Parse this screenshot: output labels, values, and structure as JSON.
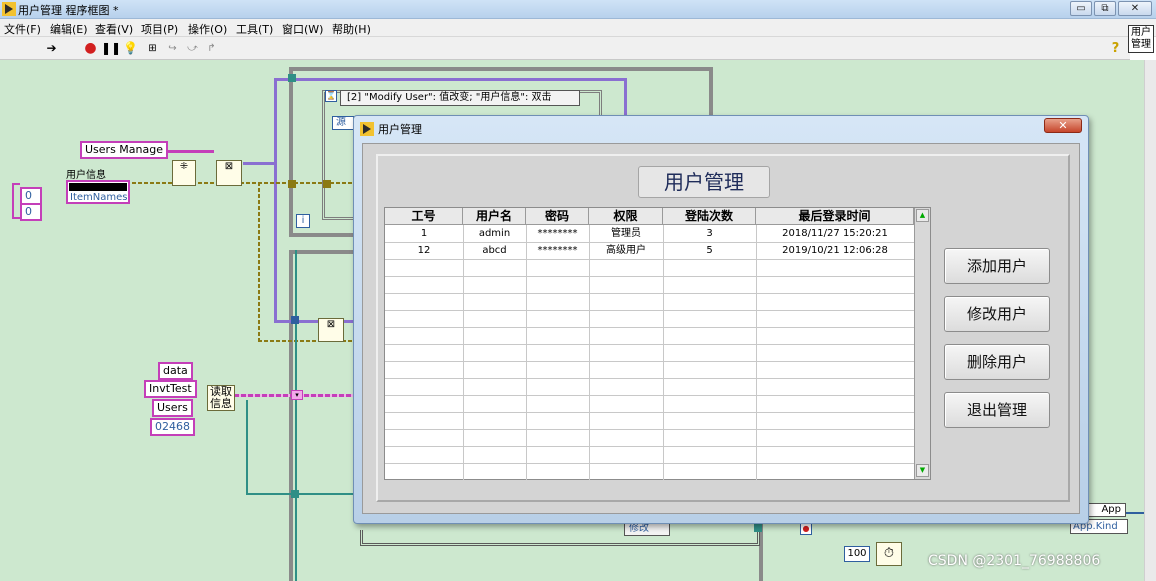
{
  "window": {
    "title": "用户管理 程序框图 *",
    "buttons": [
      "▭",
      "⧉",
      "✕"
    ]
  },
  "menu": [
    "文件(F)",
    "编辑(E)",
    "查看(V)",
    "项目(P)",
    "操作(O)",
    "工具(T)",
    "窗口(W)",
    "帮助(H)"
  ],
  "toolbar": {
    "context_icon_label": "用户\n管理",
    "icons": [
      "run-arrow-icon",
      "abort-icon",
      "pause-icon",
      "highlight-execution-icon",
      "retain-wire-icon",
      "step-into-icon",
      "step-over-icon",
      "step-out-icon",
      "help-icon"
    ]
  },
  "diagram": {
    "constants": {
      "users_manage": "Users Manage",
      "user_info": "用户信息",
      "item_names": "ItemNames",
      "num0a": "0",
      "num0b": "0",
      "data": "data",
      "invttest": "InvtTest",
      "users": "Users",
      "code": "02468",
      "read_info": "读取\n信息",
      "event_case": "[2] \"Modify User\": 值改变; \"用户信息\": 双击",
      "source_label": "源",
      "info_i": "i",
      "modify_selector": "修改",
      "num100": "100",
      "app": "App",
      "app_kind": "App.Kind"
    }
  },
  "dialog": {
    "title": "用户管理",
    "close": "✕",
    "panel_title": "用户管理",
    "table": {
      "columns": [
        "工号",
        "用户名",
        "密码",
        "权限",
        "登陆次数",
        "最后登录时间"
      ],
      "rows": [
        [
          "1",
          "admin",
          "********",
          "管理员",
          "3",
          "2018/11/27 15:20:21"
        ],
        [
          "12",
          "abcd",
          "********",
          "高级用户",
          "5",
          "2019/10/21 12:06:28"
        ]
      ]
    },
    "buttons": {
      "add": "添加用户",
      "modify": "修改用户",
      "delete": "删除用户",
      "exit": "退出管理"
    }
  },
  "watermark": "CSDN @2301_76988806",
  "colors": {
    "diagram_bg": "#cde8cf",
    "string_wire": "#c43fb9",
    "numeric_wire": "#2f5f9f",
    "cluster_wire": "#8b7a14"
  }
}
